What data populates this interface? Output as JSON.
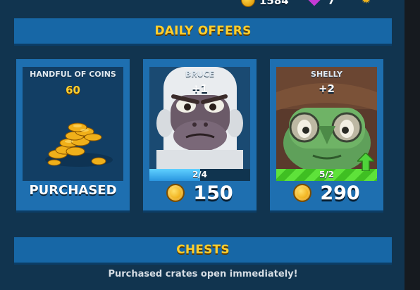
{
  "header": {
    "coins_partial": "1584",
    "gems_partial": "7"
  },
  "daily_offers": {
    "title": "DAILY OFFERS",
    "offers": [
      {
        "title": "HANDFUL OF COINS",
        "amount": "60",
        "status": "PURCHASED"
      },
      {
        "title": "BRUCE",
        "bonus": "+1",
        "progress_text": "2/4",
        "progress_fraction": 0.5,
        "price": "150",
        "progress_color": "#3fb2f0"
      },
      {
        "title": "SHELLY",
        "bonus": "+2",
        "progress_text": "5/2",
        "progress_fraction": 1.0,
        "price": "290",
        "progress_color": "#5ee23a"
      }
    ]
  },
  "chests": {
    "title": "CHESTS",
    "subtitle": "Purchased crates open immediately!"
  },
  "colors": {
    "background": "#11344f",
    "card": "#1e6fb0",
    "banner": "#1767a6",
    "accent_gold": "#ffcf2e"
  },
  "icons": [
    "coin-icon",
    "gem-icon",
    "gear-icon",
    "upgrade-arrow-icon"
  ]
}
